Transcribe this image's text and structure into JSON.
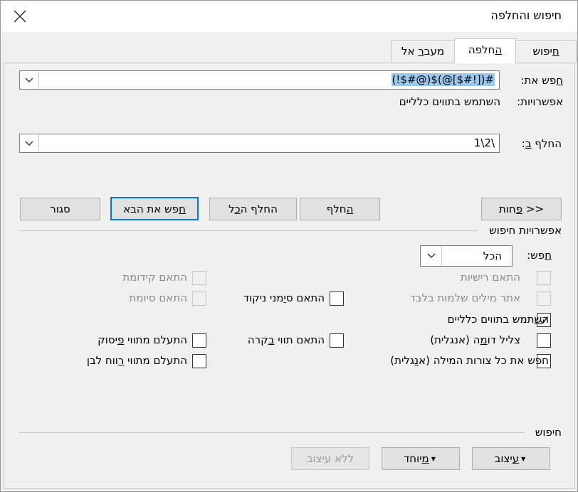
{
  "window": {
    "title": "חיפוש והחלפה",
    "close_icon": "close-icon"
  },
  "tabs": [
    {
      "label_pre": "",
      "label_u": "ח",
      "label_post": "יפוש"
    },
    {
      "label_pre": "",
      "label_u": "ה",
      "label_post": "חלפה"
    },
    {
      "label_pre": "מעב",
      "label_u": "ר",
      "label_post": " אל"
    }
  ],
  "find": {
    "label_u": "ח",
    "label_post": "פש את:",
    "value": "(!$#@)$(@[$#!])#"
  },
  "options_row": {
    "label": "אפשרויות:",
    "value": "השתמש בתווים כלליים"
  },
  "replace": {
    "label_pre": "החלף ",
    "label_u": "ב",
    "label_post": ":",
    "value": "1\\2\\"
  },
  "buttons": {
    "less": {
      "pre": "<< ",
      "u": "פ",
      "post": "חות"
    },
    "replace": {
      "pre": "",
      "u": "ה",
      "post": "חלף"
    },
    "replace_all": {
      "pre": "החלף ה",
      "u": "כ",
      "post": "ל"
    },
    "find_next": {
      "pre": "",
      "u": "ח",
      "post": "פש את הבא"
    },
    "close": {
      "label": "סגור"
    }
  },
  "search_options": {
    "heading": "אפשרויות חיפוש",
    "direction_label_u": "ח",
    "direction_label_post": "פש:",
    "direction_value": "הכל"
  },
  "checkboxes": {
    "match_case": {
      "label": "התאם רישיות",
      "checked": false,
      "disabled": true
    },
    "match_prefix": {
      "label": "התאם קידומת",
      "checked": false,
      "disabled": true
    },
    "whole_words": {
      "label": "אתר מילים שלמות בלבד",
      "checked": false,
      "disabled": true
    },
    "match_diacritics": {
      "label_pre": "התאם ס",
      "label_u": "י",
      "label_post": "מני ניקוד",
      "checked": false,
      "disabled": false
    },
    "match_suffix": {
      "label": "התאם סיומת",
      "checked": false,
      "disabled": true
    },
    "wildcards": {
      "label_pre": "ה",
      "label_u": "ש",
      "label_post": "תמש בתווים כלליים",
      "checked": true,
      "disabled": false
    },
    "sounds_like": {
      "label_pre": "צליל דו",
      "label_u": "מ",
      "label_post": "ה (אנגלית)",
      "checked": false,
      "disabled": false
    },
    "match_kashida": {
      "label_pre": "התאם תווי ",
      "label_u": "ב",
      "label_post": "קרה",
      "checked": false,
      "disabled": false
    },
    "ignore_punct": {
      "label_pre": "התעלם מתווי ",
      "label_u": "פ",
      "label_post": "יסוק",
      "checked": false,
      "disabled": false
    },
    "word_forms": {
      "label_pre": "חפש את כל צורות המילה (א",
      "label_u": "נ",
      "label_post": "גלית)",
      "checked": false,
      "disabled": false
    },
    "ignore_space": {
      "label_pre": "התעלם מתווי ",
      "label_u": "ר",
      "label_post": "ווח לבן",
      "checked": false,
      "disabled": false
    }
  },
  "find_section": {
    "heading": "חיפוש",
    "format": {
      "pre": "",
      "u": "ע",
      "post": "יצוב"
    },
    "special": {
      "pre": "",
      "u": "מ",
      "post": "יוחד"
    },
    "no_format": {
      "label": "ללא עיצוב"
    }
  },
  "icons": {
    "dropdown": "chevron-down-icon",
    "check": "check-icon",
    "menu_arrow": "triangle-down-icon"
  }
}
